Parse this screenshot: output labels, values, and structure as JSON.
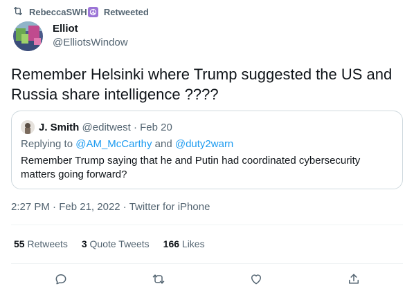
{
  "social_context": {
    "user": "RebeccaSWH",
    "action": "Retweeted"
  },
  "author": {
    "name": "Elliot",
    "handle": "@ElliotsWindow"
  },
  "tweet": {
    "text": "Remember Helsinki where Trump suggested the US and Russia share intelligence ????"
  },
  "quoted_tweet": {
    "name": "J. Smith",
    "handle": "@editwest",
    "separator": "·",
    "date": "Feb 20",
    "replying_prefix": "Replying to",
    "reply_to_1": "@AM_McCarthy",
    "reply_and": "and",
    "reply_to_2": "@duty2warn",
    "text": "Remember Trump saying that he and Putin had coordinated cybersecurity matters going forward?"
  },
  "meta": {
    "time": "2:27 PM",
    "separator": "·",
    "date": "Feb 21, 2022",
    "source": "Twitter for iPhone"
  },
  "stats": {
    "retweets_count": "55",
    "retweets_label": "Retweets",
    "quotes_count": "3",
    "quotes_label": "Quote Tweets",
    "likes_count": "166",
    "likes_label": "Likes"
  },
  "actions": [
    "reply-icon",
    "retweet-icon",
    "like-icon",
    "share-icon"
  ],
  "colors": {
    "text": "#0f1419",
    "muted": "#536471",
    "link": "#1d9bf0",
    "border": "#cfd9de",
    "divider": "#eff3f4"
  }
}
